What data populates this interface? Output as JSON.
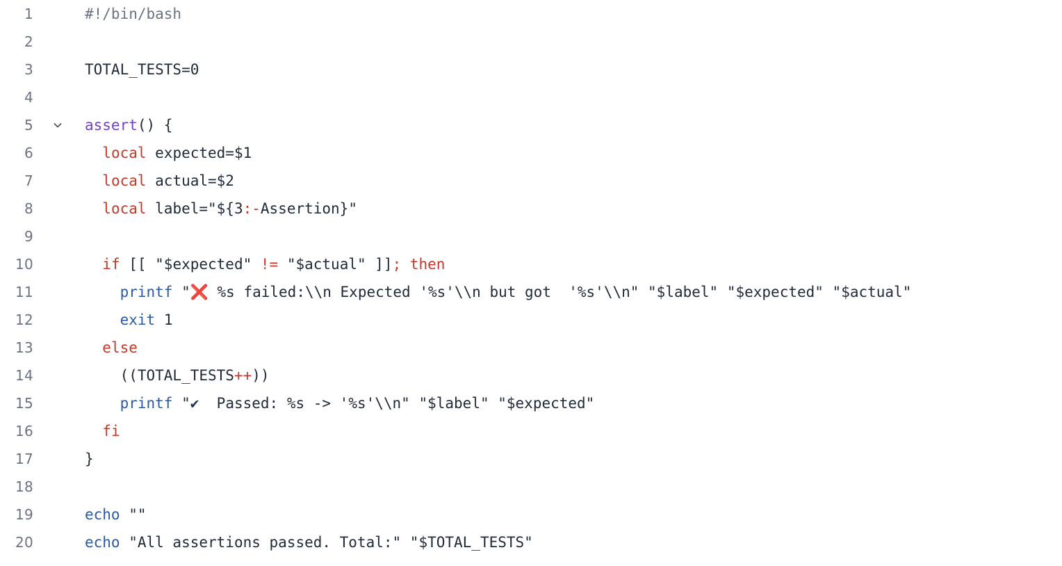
{
  "editor": {
    "language": "bash",
    "background": "#ffffff",
    "line_count_visible": 20,
    "gutter": {
      "number_color": "#6b7280",
      "fold_marker_line": 5,
      "fold_marker_icon": "chevron-down-icon",
      "fold_marker_state": "expanded"
    },
    "palette": {
      "default": "#1f2937",
      "comment": "#6b7280",
      "keyword": "#c0392b",
      "builtin": "#2c5aa0",
      "function": "#6f42c1",
      "string": "#1f2937",
      "operator": "#c0392b",
      "emoji_cross": "#e02020",
      "emoji_check": "#1f3355"
    }
  },
  "lines": [
    {
      "number": "1",
      "fold": false,
      "tokens": [
        {
          "text": "#!/bin/bash",
          "cls": "t-comment"
        }
      ]
    },
    {
      "number": "2",
      "fold": false,
      "tokens": []
    },
    {
      "number": "3",
      "fold": false,
      "tokens": [
        {
          "text": "TOTAL_TESTS=0",
          "cls": "t-def"
        }
      ]
    },
    {
      "number": "4",
      "fold": false,
      "tokens": []
    },
    {
      "number": "5",
      "fold": true,
      "tokens": [
        {
          "text": "assert",
          "cls": "t-function"
        },
        {
          "text": "() {",
          "cls": "t-punct"
        }
      ]
    },
    {
      "number": "6",
      "fold": false,
      "tokens": [
        {
          "text": "  ",
          "cls": "t-def"
        },
        {
          "text": "local",
          "cls": "t-keyword"
        },
        {
          "text": " expected=$1",
          "cls": "t-def"
        }
      ]
    },
    {
      "number": "7",
      "fold": false,
      "tokens": [
        {
          "text": "  ",
          "cls": "t-def"
        },
        {
          "text": "local",
          "cls": "t-keyword"
        },
        {
          "text": " actual=$2",
          "cls": "t-def"
        }
      ]
    },
    {
      "number": "8",
      "fold": false,
      "tokens": [
        {
          "text": "  ",
          "cls": "t-def"
        },
        {
          "text": "local",
          "cls": "t-keyword"
        },
        {
          "text": " label=\"${3",
          "cls": "t-def"
        },
        {
          "text": ":-",
          "cls": "t-operator"
        },
        {
          "text": "Assertion}\"",
          "cls": "t-def"
        }
      ]
    },
    {
      "number": "9",
      "fold": false,
      "tokens": []
    },
    {
      "number": "10",
      "fold": false,
      "tokens": [
        {
          "text": "  ",
          "cls": "t-def"
        },
        {
          "text": "if",
          "cls": "t-keyword"
        },
        {
          "text": " [[ \"$expected\" ",
          "cls": "t-def"
        },
        {
          "text": "!=",
          "cls": "t-operator"
        },
        {
          "text": " \"$actual\" ]]",
          "cls": "t-def"
        },
        {
          "text": ";",
          "cls": "t-operator"
        },
        {
          "text": " ",
          "cls": "t-def"
        },
        {
          "text": "then",
          "cls": "t-keyword"
        }
      ]
    },
    {
      "number": "11",
      "fold": false,
      "tokens": [
        {
          "text": "    ",
          "cls": "t-def"
        },
        {
          "text": "printf",
          "cls": "t-builtin"
        },
        {
          "text": " \"",
          "cls": "t-string"
        },
        {
          "text": "❌",
          "cls": "t-emoji-x"
        },
        {
          "text": " %s failed:\\\\n Expected '%s'\\\\n but got  '%s'\\\\n\" \"$label\" \"$expected\" \"$actual\"",
          "cls": "t-string"
        }
      ]
    },
    {
      "number": "12",
      "fold": false,
      "tokens": [
        {
          "text": "    ",
          "cls": "t-def"
        },
        {
          "text": "exit",
          "cls": "t-builtin"
        },
        {
          "text": " ",
          "cls": "t-def"
        },
        {
          "text": "1",
          "cls": "t-number"
        }
      ]
    },
    {
      "number": "13",
      "fold": false,
      "tokens": [
        {
          "text": "  ",
          "cls": "t-def"
        },
        {
          "text": "else",
          "cls": "t-keyword"
        }
      ]
    },
    {
      "number": "14",
      "fold": false,
      "tokens": [
        {
          "text": "    ((TOTAL_TESTS",
          "cls": "t-def"
        },
        {
          "text": "++",
          "cls": "t-operator"
        },
        {
          "text": "))",
          "cls": "t-def"
        }
      ]
    },
    {
      "number": "15",
      "fold": false,
      "tokens": [
        {
          "text": "    ",
          "cls": "t-def"
        },
        {
          "text": "printf",
          "cls": "t-builtin"
        },
        {
          "text": " \"",
          "cls": "t-string"
        },
        {
          "text": "✔",
          "cls": "t-emoji-ok"
        },
        {
          "text": "  Passed: %s -> '%s'\\\\n\" \"$label\" \"$expected\"",
          "cls": "t-string"
        }
      ]
    },
    {
      "number": "16",
      "fold": false,
      "tokens": [
        {
          "text": "  ",
          "cls": "t-def"
        },
        {
          "text": "fi",
          "cls": "t-keyword"
        }
      ]
    },
    {
      "number": "17",
      "fold": false,
      "tokens": [
        {
          "text": "}",
          "cls": "t-punct"
        }
      ]
    },
    {
      "number": "18",
      "fold": false,
      "tokens": []
    },
    {
      "number": "19",
      "fold": false,
      "tokens": [
        {
          "text": "echo",
          "cls": "t-builtin"
        },
        {
          "text": " \"\"",
          "cls": "t-string"
        }
      ]
    },
    {
      "number": "20",
      "fold": false,
      "tokens": [
        {
          "text": "echo",
          "cls": "t-builtin"
        },
        {
          "text": " \"All assertions passed. Total:\" \"$TOTAL_TESTS\"",
          "cls": "t-string"
        }
      ]
    }
  ]
}
